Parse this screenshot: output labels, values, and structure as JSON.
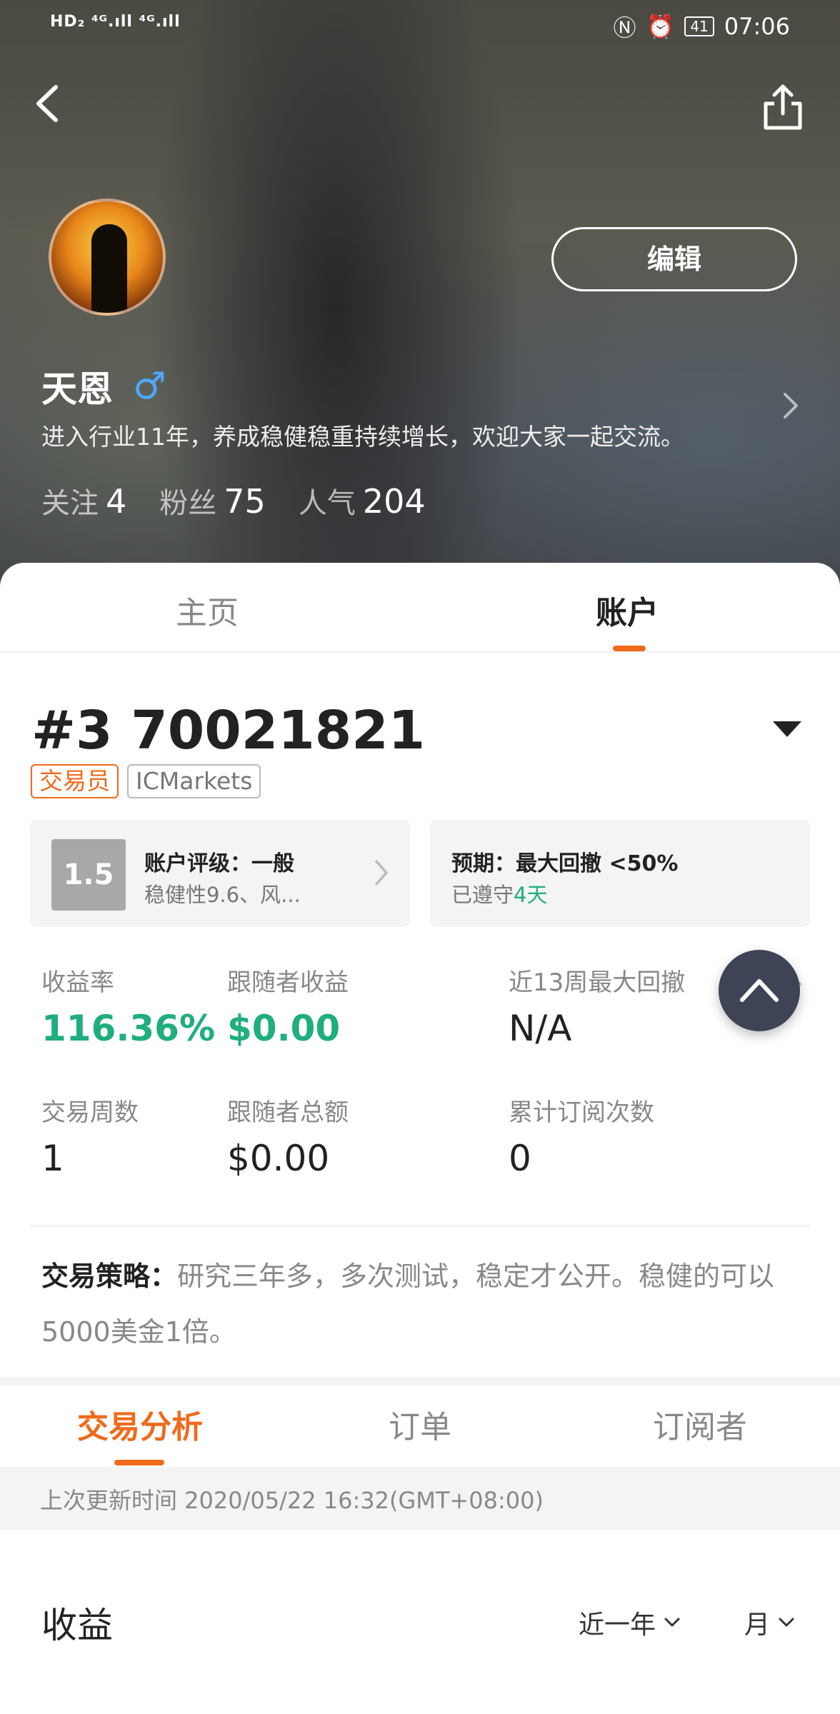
{
  "status_bar": {
    "signal": "HD₂ ⁴ᴳ.ıll ⁴ᴳ.ıll",
    "time": "07:06",
    "battery": "41"
  },
  "profile": {
    "name": "天恩",
    "gender_symbol": "♂",
    "bio": "进入行业11年，养成稳健稳重持续增长，欢迎大家一起交流。",
    "edit_label": "编辑",
    "stats": [
      {
        "label": "关注",
        "value": "4"
      },
      {
        "label": "粉丝",
        "value": "75"
      },
      {
        "label": "人气",
        "value": "204"
      }
    ]
  },
  "tabs": [
    {
      "label": "主页",
      "active": false
    },
    {
      "label": "账户",
      "active": true
    }
  ],
  "account": {
    "title": "#3 70021821",
    "tags": [
      "交易员",
      "ICMarkets"
    ],
    "rating_card": {
      "score": "1.5",
      "title": "账户评级：一般",
      "subtitle": "稳健性9.6、风..."
    },
    "expect_card": {
      "title": "预期：最大回撤 <50%",
      "subtitle_prefix": "已遵守",
      "subtitle_days": "4天"
    },
    "metrics": [
      {
        "label": "收益率",
        "value": "116.36%"
      },
      {
        "label": "跟随者收益",
        "value": "$0.00"
      },
      {
        "label": "近13周最大回撤",
        "value": "N/A"
      },
      {
        "label": "交易周数",
        "value": "1"
      },
      {
        "label": "跟随者总额",
        "value": "$0.00"
      },
      {
        "label": "累计订阅次数",
        "value": "0"
      }
    ],
    "strategy_label": "交易策略：",
    "strategy_text": "研究三年多，多次测试，稳定才公开。稳健的可以5000美金1倍。"
  },
  "sub_tabs": [
    {
      "label": "交易分析",
      "active": true
    },
    {
      "label": "订单",
      "active": false
    },
    {
      "label": "订阅者",
      "active": false
    }
  ],
  "update_time": "上次更新时间 2020/05/22 16:32(GMT+08:00)",
  "profit_section": {
    "title": "收益",
    "period_filter": "近一年",
    "unit_filter": "月"
  },
  "colors": {
    "accent": "#f06a1b",
    "positive": "#1fae7c",
    "fab": "#3e4355"
  },
  "icons": {
    "back": "chevron-left-icon",
    "share": "share-icon",
    "scroll_top": "chevron-up-icon"
  }
}
